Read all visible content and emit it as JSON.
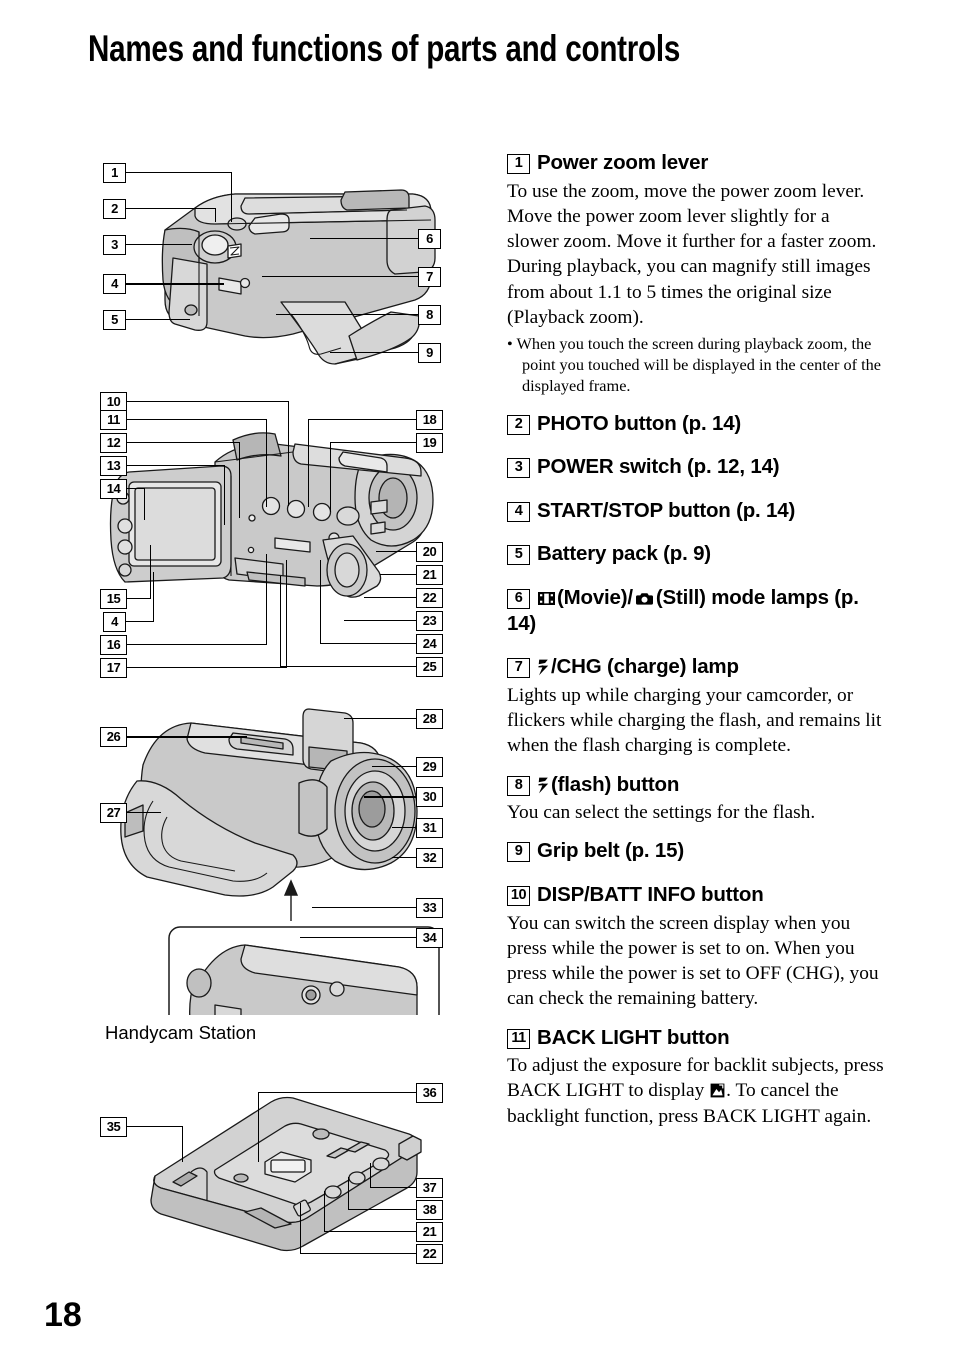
{
  "page": {
    "title": "Names and functions of parts and controls",
    "page_number": "18",
    "station_label": "Handycam Station"
  },
  "illustrations": [
    {
      "id": "camcorder-top-right-view",
      "callouts_left": [
        "1",
        "2",
        "3",
        "4",
        "5"
      ],
      "callouts_right": [
        "6",
        "7",
        "8",
        "9"
      ]
    },
    {
      "id": "camcorder-lcd-open-view",
      "callouts_left": [
        "10",
        "11",
        "12",
        "13",
        "14",
        "15",
        "4",
        "16",
        "17"
      ],
      "callouts_right": [
        "18",
        "19",
        "20",
        "21",
        "22",
        "23",
        "24",
        "25"
      ]
    },
    {
      "id": "camcorder-front-bottom-view",
      "callouts_left": [
        "26",
        "27"
      ],
      "callouts_right": [
        "28",
        "29",
        "30",
        "31",
        "32",
        "33",
        "34"
      ]
    },
    {
      "id": "handycam-station-view",
      "callouts_left": [
        "35"
      ],
      "callouts_right": [
        "36",
        "37",
        "38",
        "21",
        "22"
      ]
    }
  ],
  "items": [
    {
      "num": "1",
      "heading": "Power zoom lever",
      "body": [
        "To use the zoom, move the power zoom lever. Move the power zoom lever slightly for a slower zoom. Move it further for a faster zoom.",
        "During playback, you can magnify still images from about 1.1 to 5 times the original size (Playback zoom)."
      ],
      "note": "• When you touch the screen during playback zoom, the point you touched will be displayed in the center of the displayed frame."
    },
    {
      "num": "2",
      "heading": "PHOTO button (p. 14)",
      "body": [],
      "note": ""
    },
    {
      "num": "3",
      "heading": "POWER switch (p. 12, 14)",
      "body": [],
      "note": ""
    },
    {
      "num": "4",
      "heading": "START/STOP button (p. 14)",
      "body": [],
      "note": ""
    },
    {
      "num": "5",
      "heading": "Battery pack (p. 9)",
      "body": [],
      "note": ""
    },
    {
      "num": "6",
      "heading_pre": "",
      "heading_mid": "(Movie)/",
      "heading_post": "(Still) mode lamps (p. 14)",
      "icons": [
        "film-strip-icon",
        "still-camera-icon"
      ],
      "body": [],
      "note": ""
    },
    {
      "num": "7",
      "heading_post": "/CHG (charge) lamp",
      "icons": [
        "flash-bolt-icon"
      ],
      "body": [
        "Lights up while charging your camcorder, or flickers while charging the flash, and remains lit when the flash charging is complete."
      ],
      "note": ""
    },
    {
      "num": "8",
      "heading_post": "(flash) button",
      "icons": [
        "flash-bolt-icon"
      ],
      "body": [
        "You can select the settings for the flash."
      ],
      "note": ""
    },
    {
      "num": "9",
      "heading": "Grip belt (p. 15)",
      "body": [],
      "note": ""
    },
    {
      "num": "10",
      "heading": "DISP/BATT INFO button",
      "body": [
        "You can switch the screen display when you press while the power is set to on. When you press while the power is set to OFF (CHG), you can check the remaining battery."
      ],
      "note": ""
    },
    {
      "num": "11",
      "heading": "BACK LIGHT button",
      "body_pre": "To adjust the exposure for backlit subjects, press BACK LIGHT to display ",
      "body_post": ". To cancel the backlight function, press BACK LIGHT again.",
      "icons": [
        "backlight-icon"
      ],
      "body": [],
      "note": ""
    }
  ],
  "colors": {
    "ink": "#000000",
    "illustration_fill": "#c9c9c9",
    "illustration_light": "#e4e4e4",
    "paper": "#ffffff"
  }
}
